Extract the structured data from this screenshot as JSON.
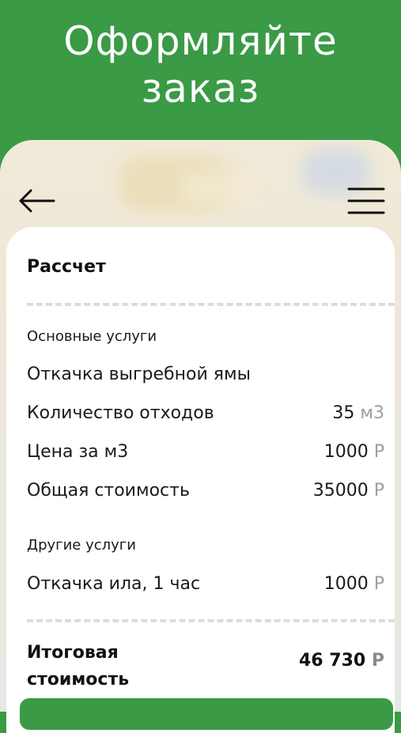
{
  "hero": {
    "title_line1": "Оформляйте",
    "title_line2": "заказ"
  },
  "colors": {
    "brand_green": "#3a9a45",
    "unit_gray": "#9e9e9e"
  },
  "topbar": {
    "back_icon": "arrow-left-icon",
    "menu_icon": "hamburger-menu-icon"
  },
  "calc": {
    "title": "Рассчет",
    "main_services": {
      "heading": "Основные услуги",
      "service_name": "Откачка выгребной ямы",
      "rows": [
        {
          "label": "Количество отходов",
          "value": "35",
          "unit": "м3"
        },
        {
          "label": "Цена за м3",
          "value": "1000",
          "unit": "Р"
        },
        {
          "label": "Общая стоимость",
          "value": "35000",
          "unit": "Р"
        }
      ]
    },
    "other_services": {
      "heading": "Другие услуги",
      "rows": [
        {
          "label": "Откачка ила, 1 час",
          "value": "1000",
          "unit": "Р"
        }
      ]
    },
    "total": {
      "label": "Итоговая стоимость",
      "value": "46 730",
      "unit": "Р"
    }
  }
}
